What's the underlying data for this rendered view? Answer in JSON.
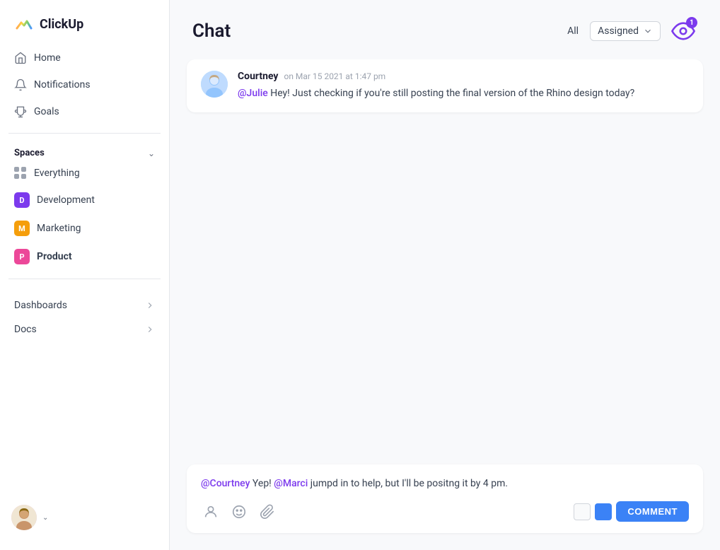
{
  "app": {
    "logo_text": "ClickUp"
  },
  "sidebar": {
    "nav_items": [
      {
        "id": "home",
        "label": "Home",
        "icon": "home-icon"
      },
      {
        "id": "notifications",
        "label": "Notifications",
        "icon": "bell-icon"
      },
      {
        "id": "goals",
        "label": "Goals",
        "icon": "trophy-icon"
      }
    ],
    "spaces_title": "Spaces",
    "spaces": [
      {
        "id": "everything",
        "label": "Everything",
        "type": "grid"
      },
      {
        "id": "development",
        "label": "Development",
        "badge": "D",
        "color": "dev"
      },
      {
        "id": "marketing",
        "label": "Marketing",
        "badge": "M",
        "color": "mkt"
      },
      {
        "id": "product",
        "label": "Product",
        "badge": "P",
        "color": "prd",
        "bold": true
      }
    ],
    "bottom_nav": [
      {
        "id": "dashboards",
        "label": "Dashboards"
      },
      {
        "id": "docs",
        "label": "Docs"
      }
    ]
  },
  "main": {
    "page_title": "Chat",
    "filter_all": "All",
    "filter_assigned": "Assigned",
    "notification_count": "1"
  },
  "messages": [
    {
      "id": "msg1",
      "author": "Courtney",
      "time": "on Mar 15 2021 at 1:47 pm",
      "mention": "@Julie",
      "text": " Hey! Just checking if you're still posting the final version of the Rhino design today?"
    }
  ],
  "reply": {
    "mention1": "@Courtney",
    "text1": " Yep! ",
    "mention2": "@Marci",
    "text2": " jumpd in to help, but I'll be positng it by 4 pm.",
    "comment_button": "COMMENT"
  }
}
